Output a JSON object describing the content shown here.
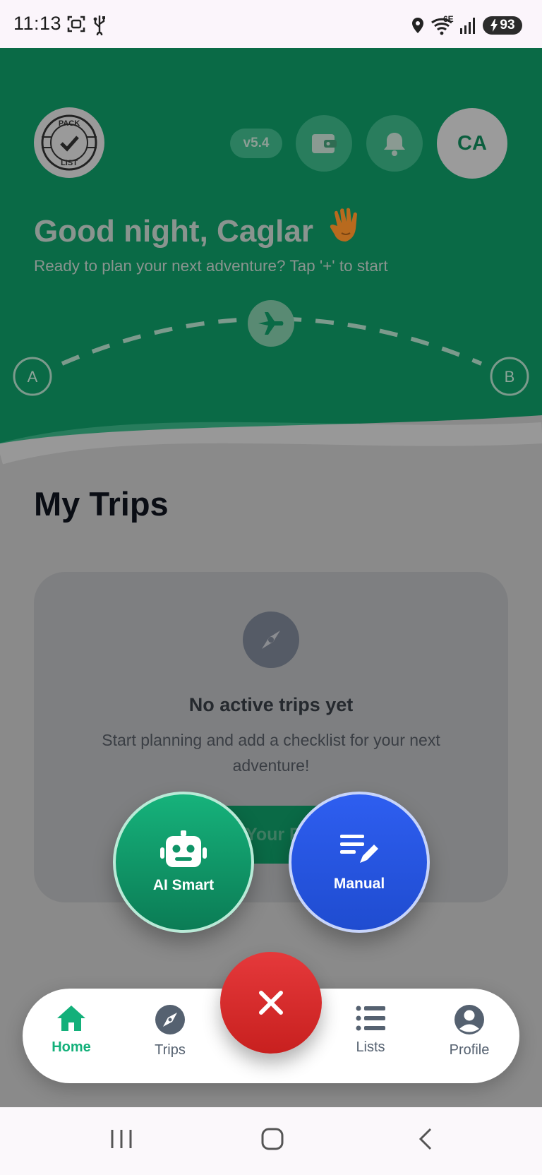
{
  "status_bar": {
    "time": "11:13",
    "network_label": "6E",
    "battery": "93",
    "icons": [
      "screenshot-icon",
      "usb-icon",
      "location-icon",
      "wifi-icon",
      "signal-icon",
      "battery-charging-icon"
    ]
  },
  "header": {
    "logo_text_top": "PACK",
    "logo_text_bottom": "LIST",
    "version": "v5.4",
    "wallet_icon": "wallet-icon",
    "notification_icon": "bell-icon",
    "avatar_initials": "CA",
    "greeting": "Good night, Caglar",
    "greeting_emoji": "👋",
    "subtitle": "Ready to plan your next adventure? Tap '+' to start",
    "route_start": "A",
    "route_end": "B",
    "route_icon": "airplane-icon"
  },
  "main": {
    "section_title": "My Trips",
    "empty_state": {
      "icon": "compass-icon",
      "title": "No active trips yet",
      "description": "Start planning and add a checklist for your next adventure!",
      "button_label": "Your F"
    }
  },
  "fab_menu": {
    "ai_label": "AI Smart",
    "ai_icon": "robot-icon",
    "manual_label": "Manual",
    "manual_icon": "edit-list-icon",
    "close_icon": "close-icon"
  },
  "bottom_nav": {
    "items": [
      {
        "label": "Home",
        "icon": "home-icon",
        "active": true
      },
      {
        "label": "Trips",
        "icon": "compass-icon",
        "active": false
      },
      {
        "label": "Lists",
        "icon": "list-icon",
        "active": false
      },
      {
        "label": "Profile",
        "icon": "profile-icon",
        "active": false
      }
    ]
  },
  "colors": {
    "header_green": "#0a6a46",
    "active_green": "#13b07a",
    "manual_blue": "#2552e0",
    "close_red": "#d62b2c"
  }
}
